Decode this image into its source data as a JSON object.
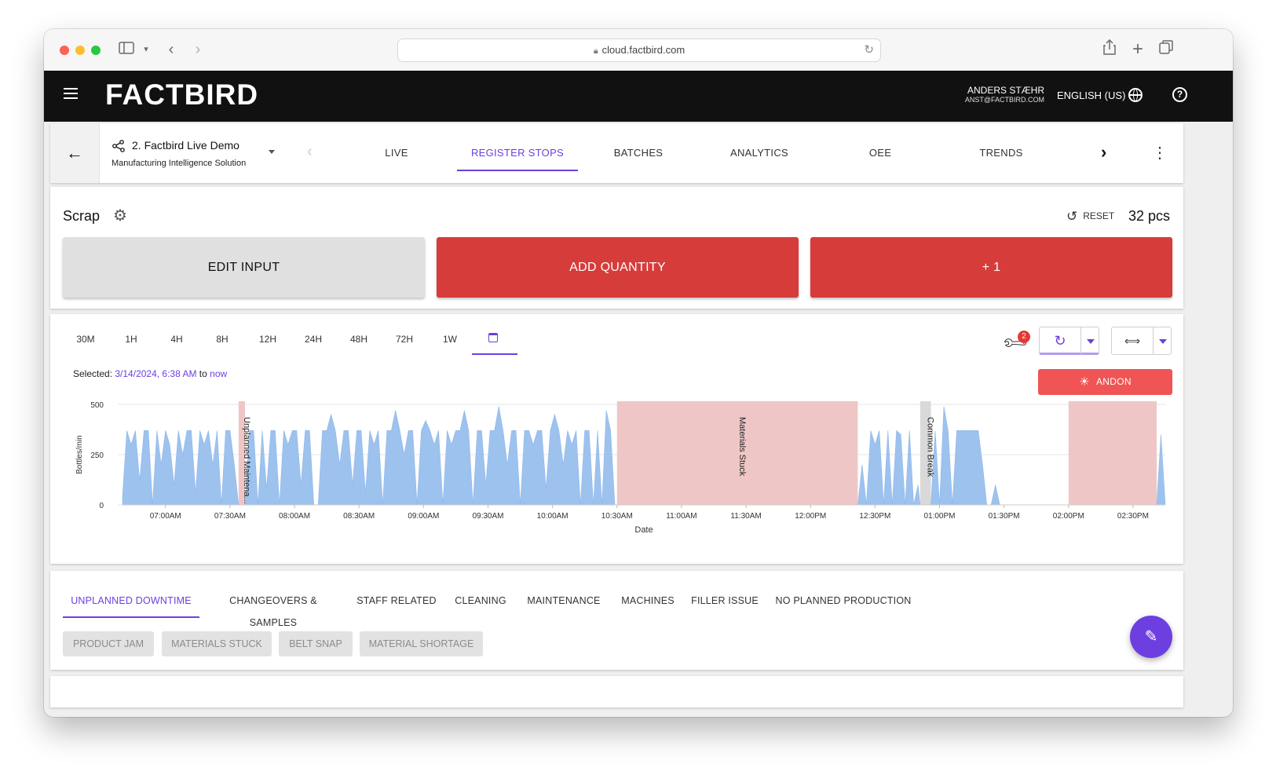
{
  "browser": {
    "url": "cloud.factbird.com"
  },
  "header": {
    "brand": "FACTBIRD",
    "user_name": "ANDERS STÆHR",
    "user_email": "ANST@FACTBIRD.COM",
    "language": "ENGLISH (US)"
  },
  "nav": {
    "line_name": "2. Factbird Live Demo",
    "line_subtitle": "Manufacturing Intelligence Solution",
    "tabs": [
      {
        "label": "LIVE",
        "active": false
      },
      {
        "label": "REGISTER STOPS",
        "active": true
      },
      {
        "label": "BATCHES",
        "active": false
      },
      {
        "label": "ANALYTICS",
        "active": false
      },
      {
        "label": "OEE",
        "active": false
      },
      {
        "label": "TRENDS",
        "active": false
      }
    ]
  },
  "scrap": {
    "title": "Scrap",
    "reset_label": "RESET",
    "count": "32 pcs",
    "edit_label": "EDIT INPUT",
    "add_label": "ADD QUANTITY",
    "plus_label": "+ 1"
  },
  "range": {
    "options": [
      "30M",
      "1H",
      "4H",
      "8H",
      "12H",
      "24H",
      "48H",
      "72H",
      "1W"
    ],
    "selected_prefix": "Selected: ",
    "selected_start": "3/14/2024, 6:38 AM",
    "selected_to": " to ",
    "selected_end": "now",
    "maintenance_badge": "2",
    "andon_label": "ANDON"
  },
  "chart_data": {
    "type": "area",
    "ylabel": "Bottles/min",
    "xlabel": "Date",
    "ylim": [
      0,
      500
    ],
    "y_ticks": [
      "0",
      "250",
      "500"
    ],
    "x_ticks": [
      "07:00AM",
      "07:30AM",
      "08:00AM",
      "08:30AM",
      "09:00AM",
      "09:30AM",
      "10:00AM",
      "10:30AM",
      "11:00AM",
      "11:30AM",
      "12:00PM",
      "12:30PM",
      "01:00PM",
      "01:30PM",
      "02:00PM",
      "02:30PM"
    ],
    "x_range_minutes": [
      400,
      885
    ],
    "stops": [
      {
        "start": 454,
        "end": 457,
        "label": "Unplanned Maintena...",
        "color": "#efc6c6"
      },
      {
        "start": 630,
        "end": 742,
        "label": "Materials Stuck",
        "color": "#efc6c6"
      },
      {
        "start": 771,
        "end": 776,
        "label": "Common Break",
        "color": "#d9d9d9"
      },
      {
        "start": 840,
        "end": 881,
        "label": "",
        "color": "#efc6c6"
      }
    ],
    "series": [
      {
        "color": "#9dc2ee",
        "x": [
          400,
          402,
          404,
          406,
          408,
          410,
          412,
          414,
          416,
          418,
          420,
          422,
          424,
          426,
          428,
          430,
          432,
          434,
          436,
          438,
          440,
          442,
          444,
          446,
          448,
          450,
          452,
          454,
          457,
          459,
          461,
          463,
          465,
          467,
          469,
          471,
          473,
          475,
          477,
          479,
          481,
          483,
          485,
          487,
          489,
          491,
          493,
          495,
          497,
          499,
          501,
          503,
          505,
          507,
          509,
          511,
          513,
          515,
          517,
          519,
          521,
          523,
          525,
          527,
          529,
          531,
          533,
          535,
          537,
          539,
          541,
          543,
          545,
          547,
          549,
          551,
          553,
          555,
          557,
          559,
          561,
          563,
          565,
          567,
          569,
          571,
          573,
          575,
          577,
          579,
          581,
          583,
          585,
          587,
          589,
          591,
          593,
          595,
          597,
          599,
          601,
          603,
          605,
          607,
          609,
          611,
          613,
          615,
          617,
          619,
          621,
          623,
          625,
          627,
          629,
          630,
          742,
          744,
          746,
          748,
          750,
          752,
          754,
          756,
          758,
          760,
          762,
          764,
          766,
          768,
          770,
          771,
          776,
          778,
          780,
          782,
          784,
          786,
          788,
          790,
          792,
          794,
          796,
          798,
          800,
          802,
          804,
          806,
          808,
          810,
          812,
          814,
          816,
          818,
          820,
          822,
          824,
          826,
          828,
          830,
          832,
          834,
          836,
          838,
          840,
          881,
          883,
          885
        ],
        "values": [
          40,
          370,
          300,
          370,
          120,
          370,
          370,
          0,
          370,
          200,
          370,
          300,
          100,
          370,
          250,
          370,
          370,
          60,
          370,
          300,
          370,
          200,
          370,
          0,
          370,
          370,
          200,
          0,
          0,
          370,
          370,
          0,
          370,
          80,
          370,
          370,
          0,
          370,
          300,
          370,
          370,
          100,
          370,
          370,
          0,
          0,
          370,
          370,
          450,
          370,
          200,
          370,
          370,
          100,
          370,
          370,
          60,
          370,
          300,
          370,
          0,
          370,
          370,
          470,
          370,
          250,
          370,
          370,
          0,
          370,
          420,
          370,
          300,
          370,
          0,
          370,
          300,
          370,
          370,
          470,
          370,
          0,
          370,
          370,
          100,
          370,
          370,
          490,
          370,
          200,
          370,
          370,
          0,
          370,
          370,
          300,
          370,
          370,
          80,
          370,
          450,
          370,
          200,
          370,
          300,
          370,
          0,
          370,
          370,
          0,
          370,
          0,
          470,
          370,
          0,
          0,
          0,
          200,
          0,
          370,
          300,
          370,
          0,
          370,
          0,
          370,
          350,
          0,
          370,
          0,
          100,
          0,
          0,
          370,
          0,
          490,
          370,
          0,
          370,
          370,
          370,
          370,
          370,
          370,
          200,
          0,
          0,
          100,
          0,
          0,
          0,
          0,
          0,
          0,
          0,
          0,
          0,
          0,
          0,
          0,
          0,
          0,
          0,
          0,
          0,
          0,
          350,
          0
        ]
      }
    ]
  },
  "categories": {
    "tabs": [
      "UNPLANNED DOWNTIME",
      "CHANGEOVERS & SAMPLES",
      "STAFF RELATED",
      "CLEANING",
      "MAINTENANCE",
      "MACHINES",
      "FILLER ISSUE",
      "NO PLANNED PRODUCTION"
    ],
    "chips": [
      "PRODUCT JAM",
      "MATERIALS STUCK",
      "BELT SNAP",
      "MATERIAL SHORTAGE"
    ]
  }
}
